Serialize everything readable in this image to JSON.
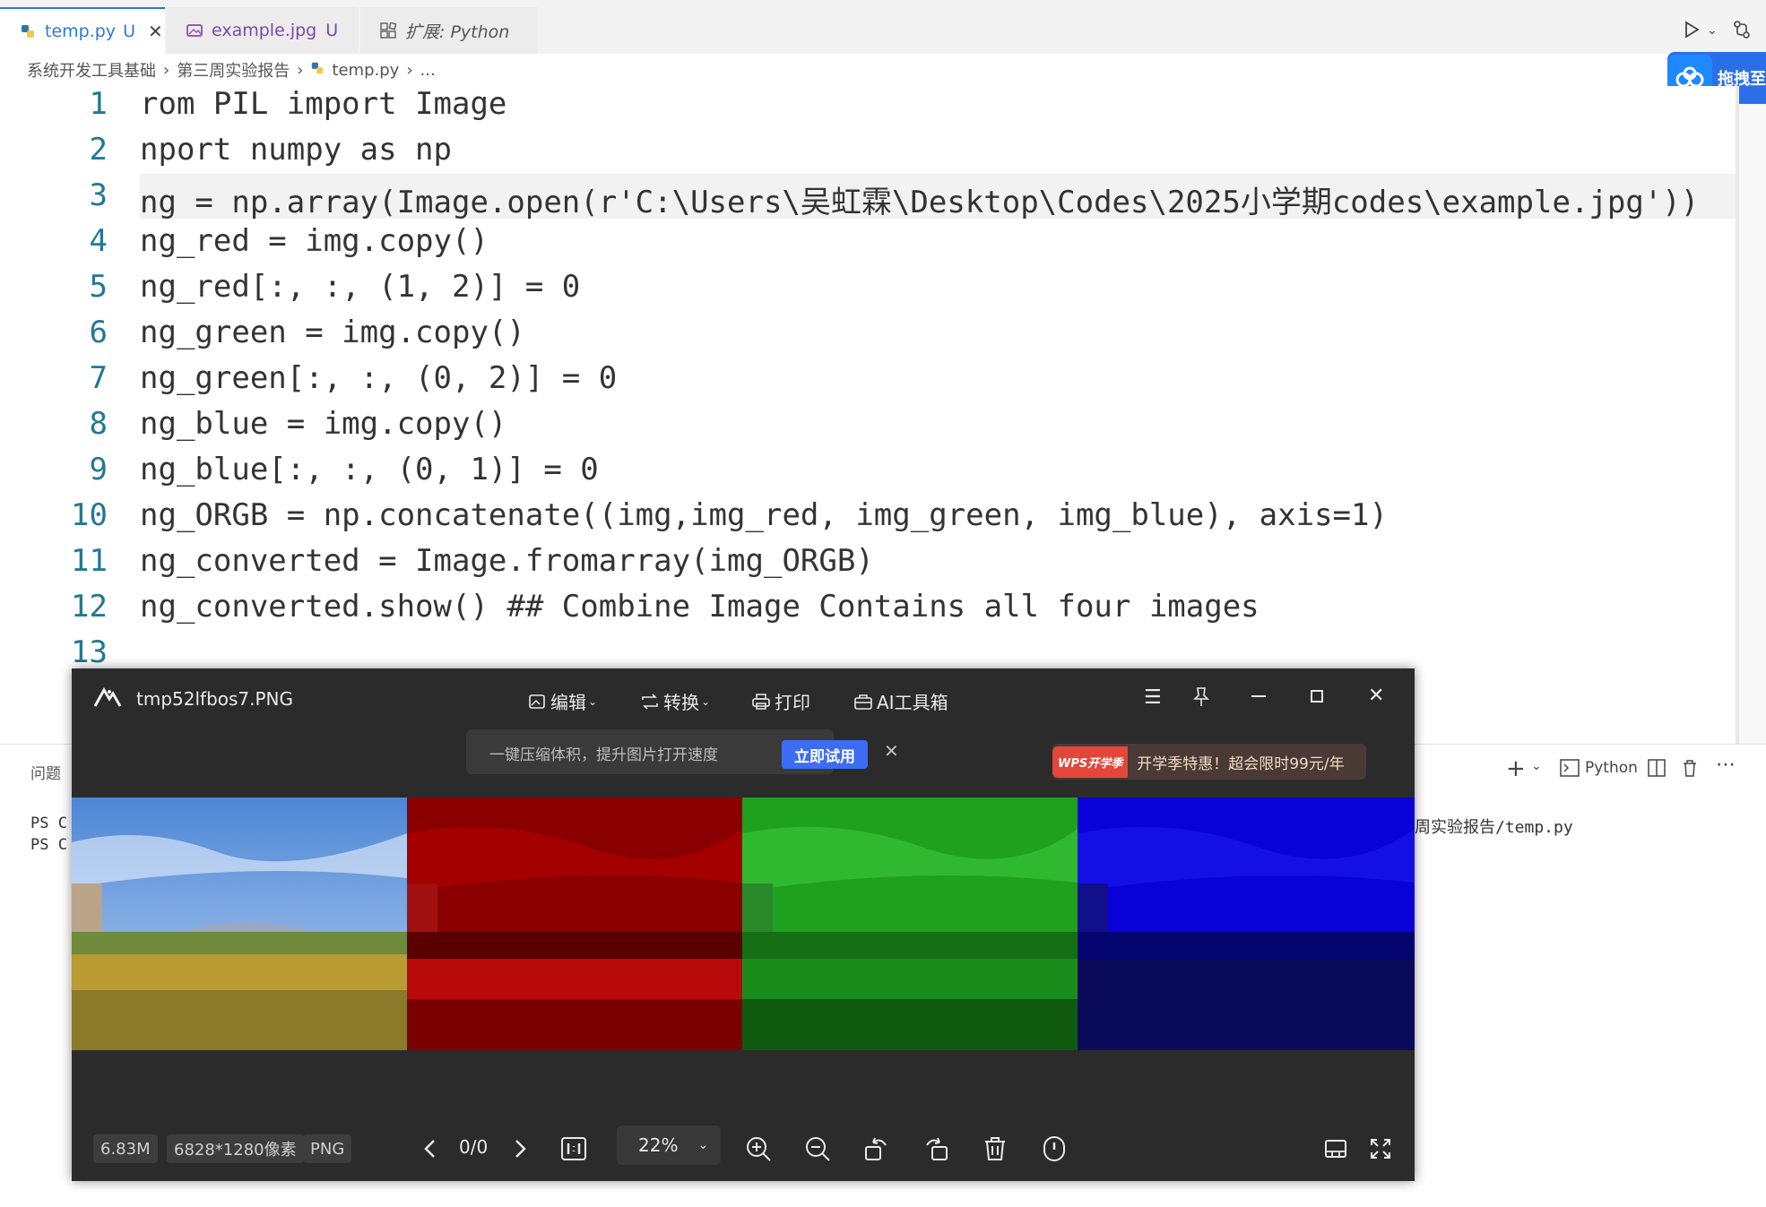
{
  "tabs": [
    {
      "label": "temp.py",
      "status": "U",
      "active": true
    },
    {
      "label": "example.jpg",
      "status": "U",
      "active": false
    },
    {
      "label": "扩展: Python",
      "active": false
    }
  ],
  "breadcrumb": [
    "系统开发工具基础",
    "第三周实验报告",
    "temp.py",
    "..."
  ],
  "floating_badge": {
    "label": "拖拽至"
  },
  "editor": {
    "line_numbers": [
      "1",
      "2",
      "3",
      "4",
      "5",
      "6",
      "7",
      "8",
      "9",
      "10",
      "11",
      "12",
      "13"
    ],
    "lines": [
      "rom PIL import Image",
      "nport numpy as np",
      "ng = np.array(Image.open(r'C:\\Users\\吴虹霖\\Desktop\\Codes\\2025小学期codes\\example.jpg'))",
      "ng_red = img.copy()",
      "ng_red[:, :, (1, 2)] = 0",
      "ng_green = img.copy()",
      "ng_green[:, :, (0, 2)] = 0",
      "ng_blue = img.copy()",
      "ng_blue[:, :, (0, 1)] = 0",
      "ng_ORGB = np.concatenate((img,img_red, img_green, img_blue), axis=1)",
      "ng_converted = Image.fromarray(img_ORGB)",
      "ng_converted.show() ## Combine Image Contains all four images",
      ""
    ]
  },
  "panel": {
    "tab_label": "问题",
    "terminal_lines": [
      "PS C",
      "PS C"
    ],
    "terminal_tail": "周实验报告/temp.py",
    "terminal_profile": "Python"
  },
  "viewer": {
    "filename": "tmp52lfbos7.PNG",
    "menu": {
      "edit": "编辑",
      "convert": "转换",
      "print": "打印",
      "ai": "AI工具箱"
    },
    "banner_text": "一键压缩体积，提升图片打开速度",
    "banner_button": "立即试用",
    "promo_badge": "WPS开学季",
    "promo_text": "开学季特惠！超会限时99元/年",
    "file_size": "6.83M",
    "dimensions": "6828*1280像素",
    "format": "PNG",
    "page_counter": "0/0",
    "zoom": "22%"
  }
}
